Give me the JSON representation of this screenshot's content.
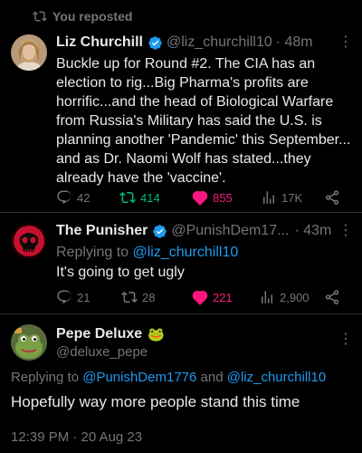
{
  "repost_banner": {
    "label": "You reposted"
  },
  "tweet1": {
    "name": "Liz Churchill",
    "handle": "@liz_churchill10",
    "time": "· 48m",
    "text_lines": [
      "Buckle up for Round #2. The CIA has an",
      "election to rig...Big Pharma's profits are",
      "horrific...and the head of Biological Warfare",
      "from Russia's Military has said the U.S. is",
      "planning another 'Pandemic' this September...",
      "and as Dr. Naomi Wolf has stated...they",
      "already have the 'vaccine'."
    ],
    "replies": "42",
    "reposts": "414",
    "likes": "855",
    "views": "17K"
  },
  "tweet2": {
    "name": "The Punisher",
    "handle": "@PunishDem17...",
    "time": "· 43m",
    "replying_prefix": "Replying to",
    "replying_to": "@liz_churchill10",
    "text": "It's going to get ugly",
    "replies": "21",
    "reposts": "28",
    "likes": "221",
    "views": "2,900"
  },
  "tweet3": {
    "name": "Pepe Deluxe",
    "emoji": "🐸",
    "handle": "@deluxe_pepe",
    "replying_prefix": "Replying to",
    "replying_to_1": "@PunishDem1776",
    "replying_and": "and",
    "replying_to_2": "@liz_churchill10",
    "text": "Hopefully way more people stand this time",
    "timestamp": "12:39 PM · 20 Aug 23"
  },
  "colors": {
    "background": "#000000",
    "text": "#e7e9ea",
    "muted": "#71767b",
    "link": "#1d9bf0",
    "repost_active": "#00ba7c",
    "like_active": "#f91880",
    "verified": "#1d9bf0"
  }
}
